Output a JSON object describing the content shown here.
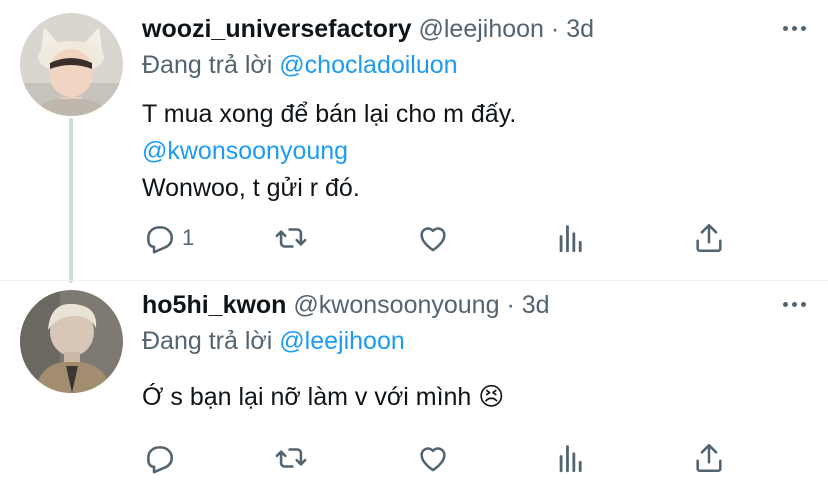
{
  "tweets": [
    {
      "name": "woozi_universefactory",
      "handle": "@leejihoon",
      "dot": "·",
      "time": "3d",
      "replying_prefix": "Đang trả lời",
      "replying_to": "@chocladoiluon",
      "lines": {
        "l1": "T mua xong để bán lại cho m đấy.",
        "l2": "@kwonsoonyoung",
        "l3": "Wonwoo, t gửi r đó."
      },
      "reply_count": "1",
      "avatar_icon": "avatar-photo-cat-ear-hat"
    },
    {
      "name": "ho5hi_kwon",
      "handle": "@kwonsoonyoung",
      "dot": "·",
      "time": "3d",
      "replying_prefix": "Đang trả lời",
      "replying_to": "@leejihoon",
      "lines": {
        "l1": "Ớ s bạn lại nỡ làm v với mình 😣"
      },
      "reply_count": "",
      "avatar_icon": "avatar-photo-blond-hair"
    }
  ],
  "icons": [
    "reply-icon",
    "retweet-icon",
    "like-icon",
    "stats-icon",
    "share-icon",
    "more-icon"
  ],
  "colors": {
    "accent": "#1d9bf0",
    "secondary_text": "#536471",
    "thread_line": "#cfd9de"
  }
}
